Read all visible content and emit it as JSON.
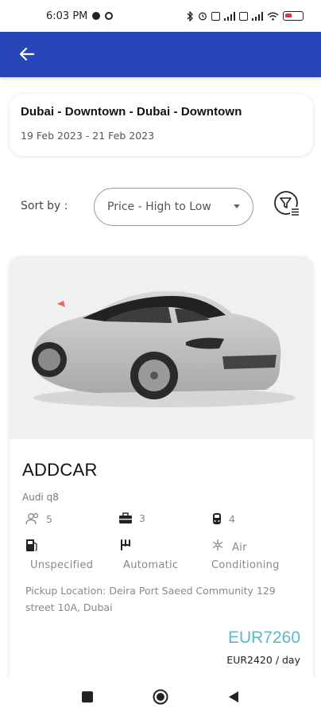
{
  "status": {
    "time": "6:03 PM",
    "battery_color": "#e53935"
  },
  "header": {
    "back_icon": "arrow-left-icon",
    "color": "#2846b8"
  },
  "search_summary": {
    "route": "Dubai - Downtown - Dubai - Downtown",
    "dates": "19 Feb 2023 - 21 Feb 2023"
  },
  "sort": {
    "label": "Sort by :",
    "selected": "Price - High to Low",
    "filter_icon": "filter-icon"
  },
  "car": {
    "supplier": "ADDCAR",
    "model": "Audi q8",
    "specs": {
      "passengers": "5",
      "luggage": "3",
      "doors": "4",
      "fuel": "Unspecified",
      "transmission": "Automatic",
      "ac_line1": "Air",
      "ac_line2": "Conditioning"
    },
    "pickup": "Pickup Location: Deira Port Saeed Community 129 street 10A, Dubai",
    "price_total": "EUR7260",
    "price_day": "EUR2420 / day",
    "price_color": "#5bb8c9"
  },
  "nav": {
    "recents_icon": "square-icon",
    "home_icon": "circle-icon",
    "back_icon": "triangle-back-icon"
  }
}
